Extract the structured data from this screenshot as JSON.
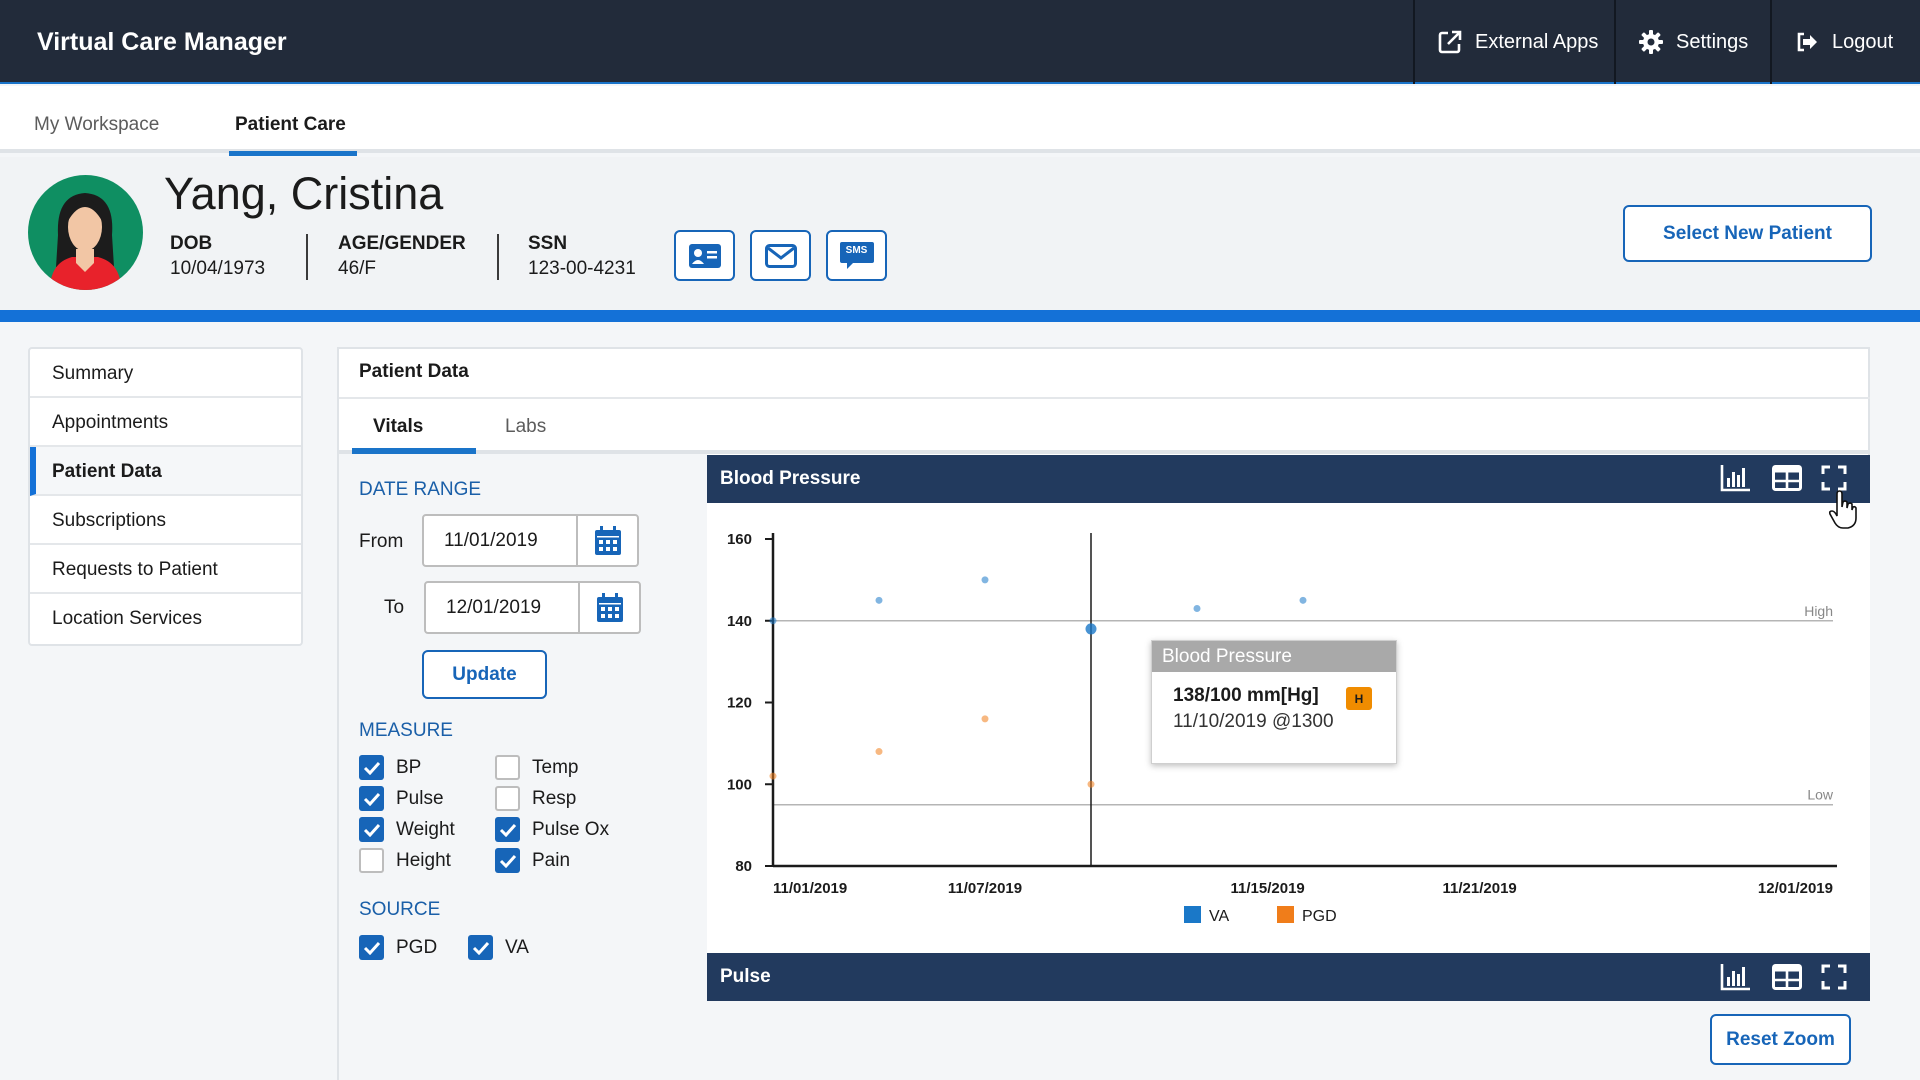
{
  "header": {
    "app_title": "Virtual Care Manager",
    "external_apps": "External Apps",
    "settings": "Settings",
    "logout": "Logout"
  },
  "nav": {
    "tabs": [
      "My Workspace",
      "Patient Care"
    ]
  },
  "patient": {
    "name": "Yang, Cristina",
    "dob_label": "DOB",
    "dob": "10/04/1973",
    "age_gender_label": "AGE/GENDER",
    "age_gender": "46/F",
    "ssn_label": "SSN",
    "ssn": "123-00-4231",
    "sms_label": "SMS",
    "select_new_patient": "Select New Patient"
  },
  "sidebar": {
    "items": [
      {
        "label": "Summary",
        "active": false
      },
      {
        "label": "Appointments",
        "active": false
      },
      {
        "label": "Patient Data",
        "active": true
      },
      {
        "label": "Subscriptions",
        "active": false
      },
      {
        "label": "Requests to Patient",
        "active": false
      },
      {
        "label": "Location Services",
        "active": false
      }
    ]
  },
  "panel": {
    "title": "Patient Data",
    "tabs": [
      "Vitals",
      "Labs"
    ]
  },
  "filters": {
    "date_range_title": "DATE RANGE",
    "from_label": "From",
    "from_value": "11/01/2019",
    "to_label": "To",
    "to_value": "12/01/2019",
    "update": "Update",
    "measure_title": "MEASURE",
    "measures": [
      {
        "label": "BP",
        "checked": true
      },
      {
        "label": "Pulse",
        "checked": true
      },
      {
        "label": "Weight",
        "checked": true
      },
      {
        "label": "Height",
        "checked": false
      },
      {
        "label": "Temp",
        "checked": false
      },
      {
        "label": "Resp",
        "checked": false
      },
      {
        "label": "Pulse Ox",
        "checked": true
      },
      {
        "label": "Pain",
        "checked": true
      }
    ],
    "source_title": "SOURCE",
    "sources": [
      {
        "label": "PGD",
        "checked": true
      },
      {
        "label": "VA",
        "checked": true
      }
    ]
  },
  "bp_panel": {
    "title": "Blood Pressure",
    "tooltip": {
      "title": "Blood Pressure",
      "value": "138/100 mm[Hg]",
      "flag": "H",
      "time": "11/10/2019 @1300"
    }
  },
  "pulse_panel": {
    "title": "Pulse",
    "reset_zoom": "Reset Zoom"
  },
  "colors": {
    "topbar": "#222b3a",
    "accent_blue": "#1471d7",
    "primary_button": "#1765b8",
    "chart_header": "#223a5e",
    "va_series": "#1a78c8",
    "pgd_series": "#f07d1a"
  },
  "chart_data": {
    "type": "scatter",
    "title": "Blood Pressure",
    "x_type": "date",
    "x_ticks": [
      "11/01/2019",
      "11/07/2019",
      "11/15/2019",
      "11/21/2019",
      "12/01/2019"
    ],
    "y_ticks": [
      80,
      100,
      120,
      140,
      160
    ],
    "ylim": [
      80,
      160
    ],
    "xlim": [
      "11/01/2019",
      "12/01/2019"
    ],
    "reference_lines": [
      {
        "label": "High",
        "y": 140
      },
      {
        "label": "Low",
        "y": 95
      }
    ],
    "crosshair_x": "11/10/2019",
    "series": [
      {
        "name": "VA",
        "color": "#1a78c8",
        "points": [
          {
            "x": "11/01/2019",
            "y": 140
          },
          {
            "x": "11/04/2019",
            "y": 145
          },
          {
            "x": "11/07/2019",
            "y": 150
          },
          {
            "x": "11/10/2019",
            "y": 138
          },
          {
            "x": "11/13/2019",
            "y": 143
          },
          {
            "x": "11/16/2019",
            "y": 145
          }
        ]
      },
      {
        "name": "PGD",
        "color": "#f07d1a",
        "points": [
          {
            "x": "11/01/2019",
            "y": 102
          },
          {
            "x": "11/04/2019",
            "y": 108
          },
          {
            "x": "11/07/2019",
            "y": 116
          },
          {
            "x": "11/10/2019",
            "y": 100
          }
        ]
      }
    ],
    "legend": [
      "VA",
      "PGD"
    ],
    "legend_position": "bottom",
    "grid": false
  }
}
